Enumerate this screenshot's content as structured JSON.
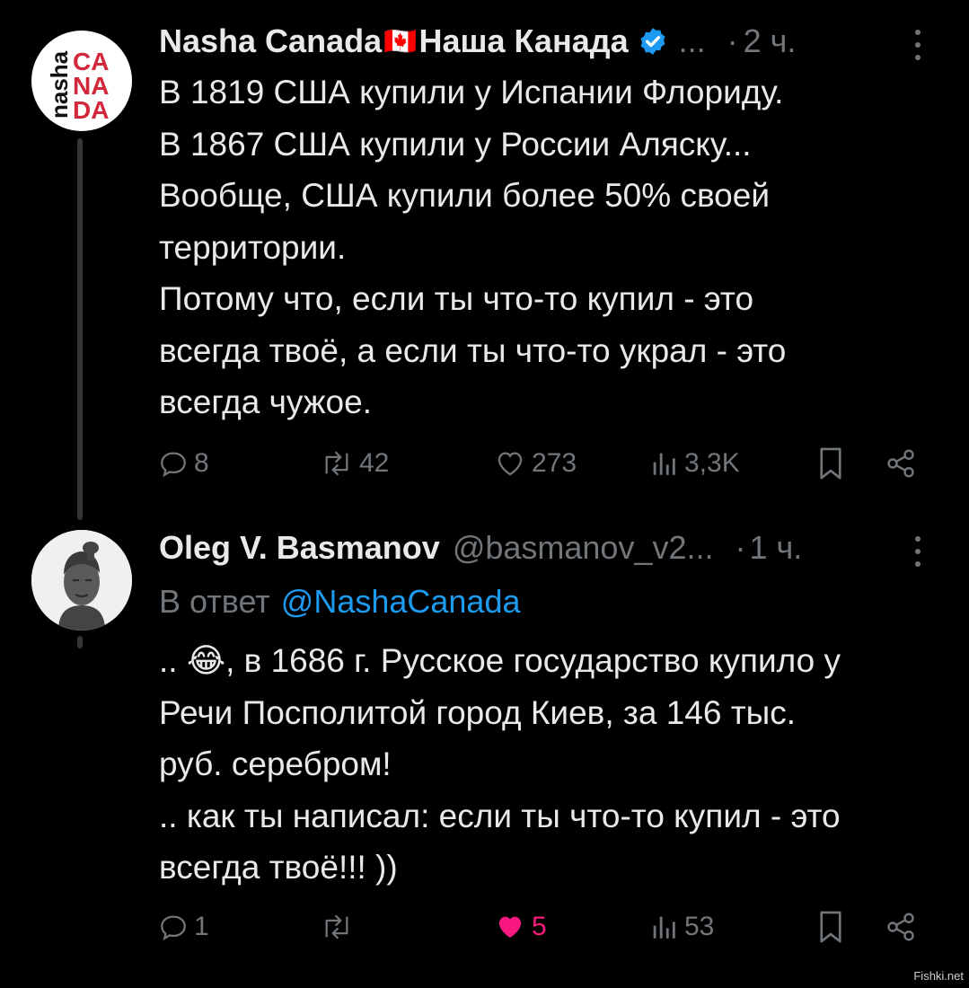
{
  "posts": [
    {
      "avatar_logo": [
        "nasha",
        "CA",
        "NA",
        "DA"
      ],
      "display_name": "Nasha Canada",
      "flag": "🇨🇦",
      "display_name_suffix": "Наша Канада",
      "handle": "...",
      "separator": "·",
      "time": "2 ч.",
      "lines": [
        "В 1819 США купили у Испании Флориду.",
        "В 1867 США купили у России Аляску...",
        "Вообще, США купили более 50% своей",
        "территории.",
        "Потому что, если ты что-то купил - это",
        "всегда твоё, а если ты что-то украл - это",
        "всегда чужое."
      ],
      "replies": "8",
      "reposts": "42",
      "likes": "273",
      "views": "3,3K"
    },
    {
      "display_name": "Oleg V. Basmanov",
      "handle": "@basmanov_v2...",
      "separator": "·",
      "time": "1 ч.",
      "reply_to_label": "В ответ",
      "reply_to_handle": "@NashaCanada",
      "emoji": "😂",
      "first_line_prefix": "..",
      "first_line_rest": ", в 1686 г. Русское государство купило у",
      "lines": [
        "Речи Посполитой город Киев, за 146 тыс.",
        "руб. серебром!",
        ".. как ты написал: если ты что-то купил - это",
        "всегда твоё!!! ))"
      ],
      "replies": "1",
      "reposts": "",
      "likes": "5",
      "views": "53"
    }
  ],
  "colors": {
    "background": "#000000",
    "text": "#e7e9ea",
    "muted": "#71767b",
    "verified": "#1d9bf0",
    "like": "#f91880",
    "logo_red": "#d3283b"
  },
  "watermark": "Fishki.net"
}
